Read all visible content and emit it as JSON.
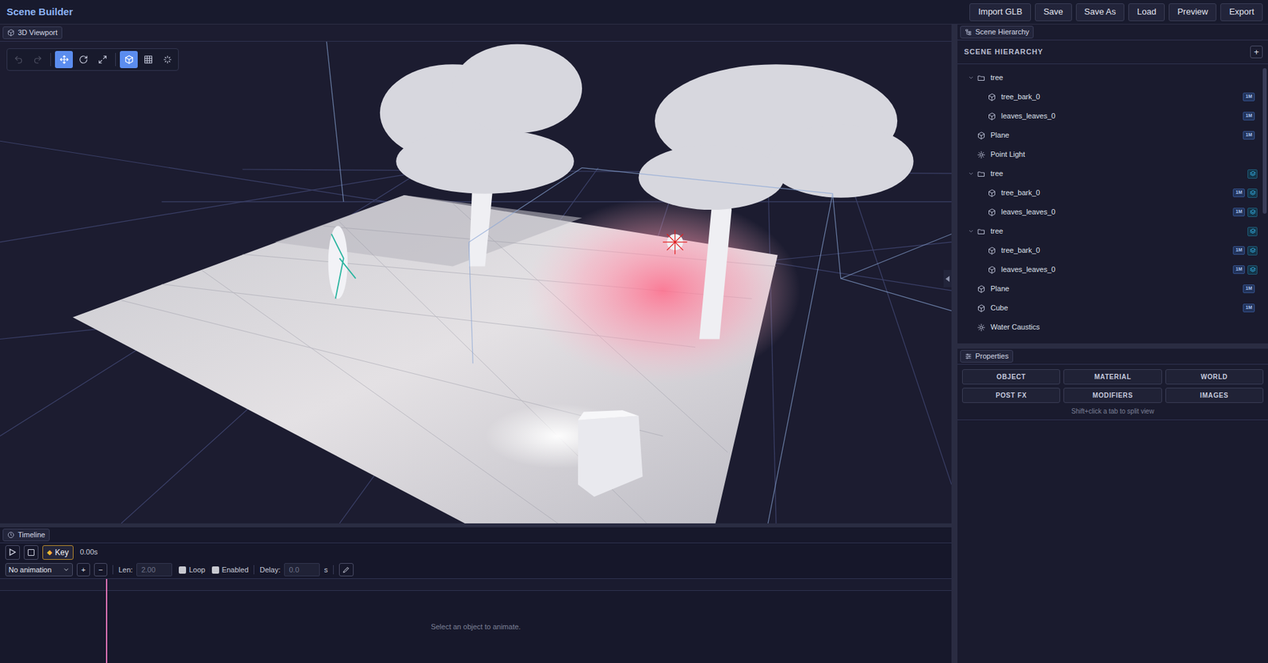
{
  "app": {
    "title": "Scene Builder"
  },
  "header_buttons": [
    "Import GLB",
    "Save",
    "Save As",
    "Load",
    "Preview",
    "Export"
  ],
  "viewport": {
    "tab": "3D Viewport",
    "tools": [
      {
        "kind": "undo",
        "selected": false,
        "disabled": true
      },
      {
        "kind": "redo",
        "selected": false,
        "disabled": true
      },
      {
        "kind": "move",
        "selected": true,
        "disabled": false
      },
      {
        "kind": "rotate",
        "selected": false,
        "disabled": false
      },
      {
        "kind": "scale",
        "selected": false,
        "disabled": false
      },
      {
        "kind": "solid",
        "selected": true,
        "disabled": false
      },
      {
        "kind": "grid",
        "selected": false,
        "disabled": false
      },
      {
        "kind": "effects",
        "selected": false,
        "disabled": false
      }
    ]
  },
  "hierarchy": {
    "tab": "Scene Hierarchy",
    "title": "SCENE HIERARCHY",
    "add_button": "+",
    "items": [
      {
        "label": "tree",
        "kind": "group",
        "depth": 0,
        "expanded": true,
        "instanced": false
      },
      {
        "label": "tree_bark_0",
        "kind": "mesh",
        "depth": 1,
        "badge": "1M",
        "instanced": false
      },
      {
        "label": "leaves_leaves_0",
        "kind": "mesh",
        "depth": 1,
        "badge": "1M",
        "instanced": false
      },
      {
        "label": "Plane",
        "kind": "mesh",
        "depth": 0,
        "badge": "1M",
        "instanced": false
      },
      {
        "label": "Point Light",
        "kind": "light",
        "depth": 0,
        "instanced": false
      },
      {
        "label": "tree",
        "kind": "group",
        "depth": 0,
        "expanded": true,
        "instanced": true
      },
      {
        "label": "tree_bark_0",
        "kind": "mesh",
        "depth": 1,
        "badge": "1M",
        "instanced": true
      },
      {
        "label": "leaves_leaves_0",
        "kind": "mesh",
        "depth": 1,
        "badge": "1M",
        "instanced": true
      },
      {
        "label": "tree",
        "kind": "group",
        "depth": 0,
        "expanded": true,
        "instanced": true
      },
      {
        "label": "tree_bark_0",
        "kind": "mesh",
        "depth": 1,
        "badge": "1M",
        "instanced": true
      },
      {
        "label": "leaves_leaves_0",
        "kind": "mesh",
        "depth": 1,
        "badge": "1M",
        "instanced": true
      },
      {
        "label": "Plane",
        "kind": "mesh",
        "depth": 0,
        "badge": "1M",
        "instanced": false
      },
      {
        "label": "Cube",
        "kind": "mesh",
        "depth": 0,
        "badge": "1M",
        "instanced": false
      },
      {
        "label": "Water Caustics",
        "kind": "light",
        "depth": 0,
        "instanced": false
      }
    ]
  },
  "properties": {
    "tab": "Properties",
    "tabs": [
      {
        "label": "OBJECT",
        "selected": false
      },
      {
        "label": "MATERIAL",
        "selected": false
      },
      {
        "label": "WORLD",
        "selected": false
      },
      {
        "label": "POST FX",
        "selected": false
      },
      {
        "label": "MODIFIERS",
        "selected": false
      },
      {
        "label": "IMAGES",
        "selected": false
      }
    ],
    "hint": "Shift+click a tab to split view"
  },
  "timeline": {
    "tab": "Timeline",
    "key_icon": "◆",
    "key": "Key",
    "time": "0.00s",
    "animation_select": "No animation",
    "add": "+",
    "remove": "−",
    "len_label": "Len:",
    "len": "2.00",
    "loop": {
      "label": "Loop",
      "checked": false
    },
    "enabled": {
      "label": "Enabled",
      "checked": false
    },
    "delay_label": "Delay:",
    "delay": "0.0",
    "delay_unit": "s",
    "empty": "Select an object to animate."
  }
}
